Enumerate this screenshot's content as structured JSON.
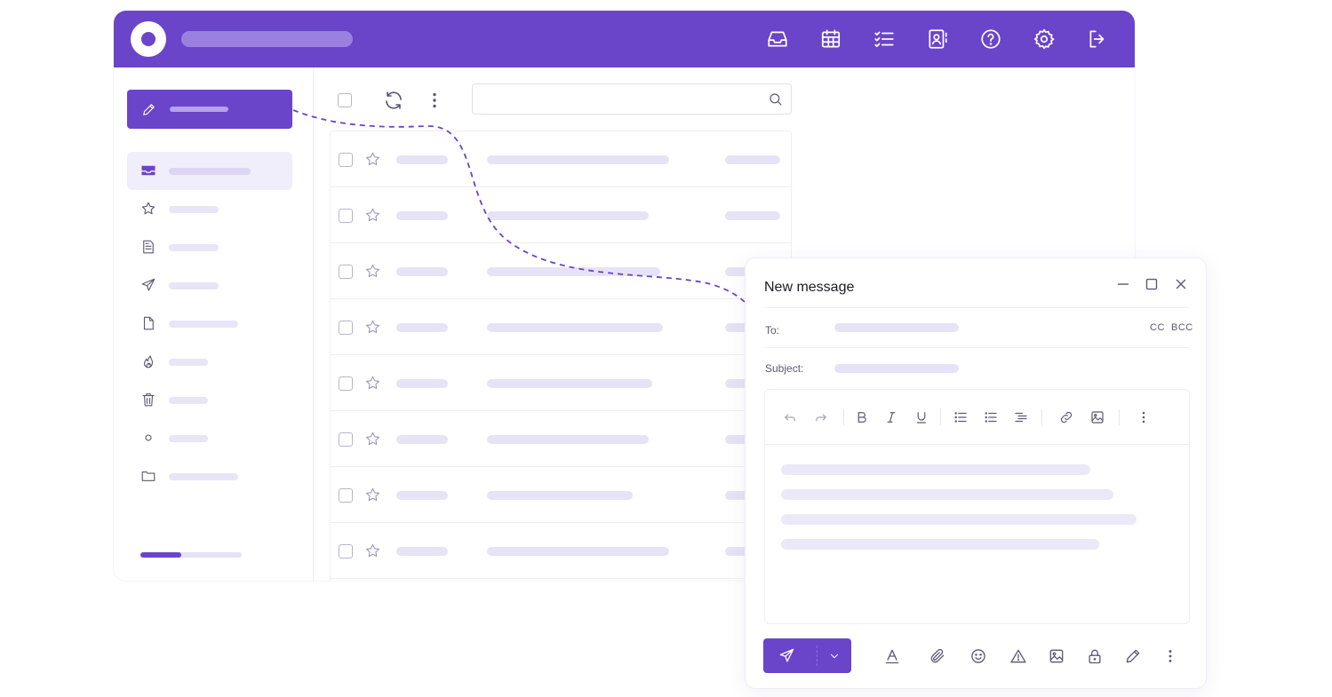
{
  "header": {
    "icons": [
      "inbox-icon",
      "calendar-icon",
      "tasks-icon",
      "contacts-icon",
      "help-icon",
      "settings-icon",
      "logout-icon"
    ]
  },
  "sidebar": {
    "storage_used_fraction": 0.4
  },
  "search": {
    "placeholder": ""
  },
  "composer": {
    "title": "New message",
    "to_label": "To:",
    "subject_label": "Subject:",
    "cc_label": "CC",
    "bcc_label": "BCC"
  },
  "colors": {
    "brand": "#6a44c9",
    "placeholder_bar": "#e6e3f6",
    "border": "#efedf5"
  }
}
